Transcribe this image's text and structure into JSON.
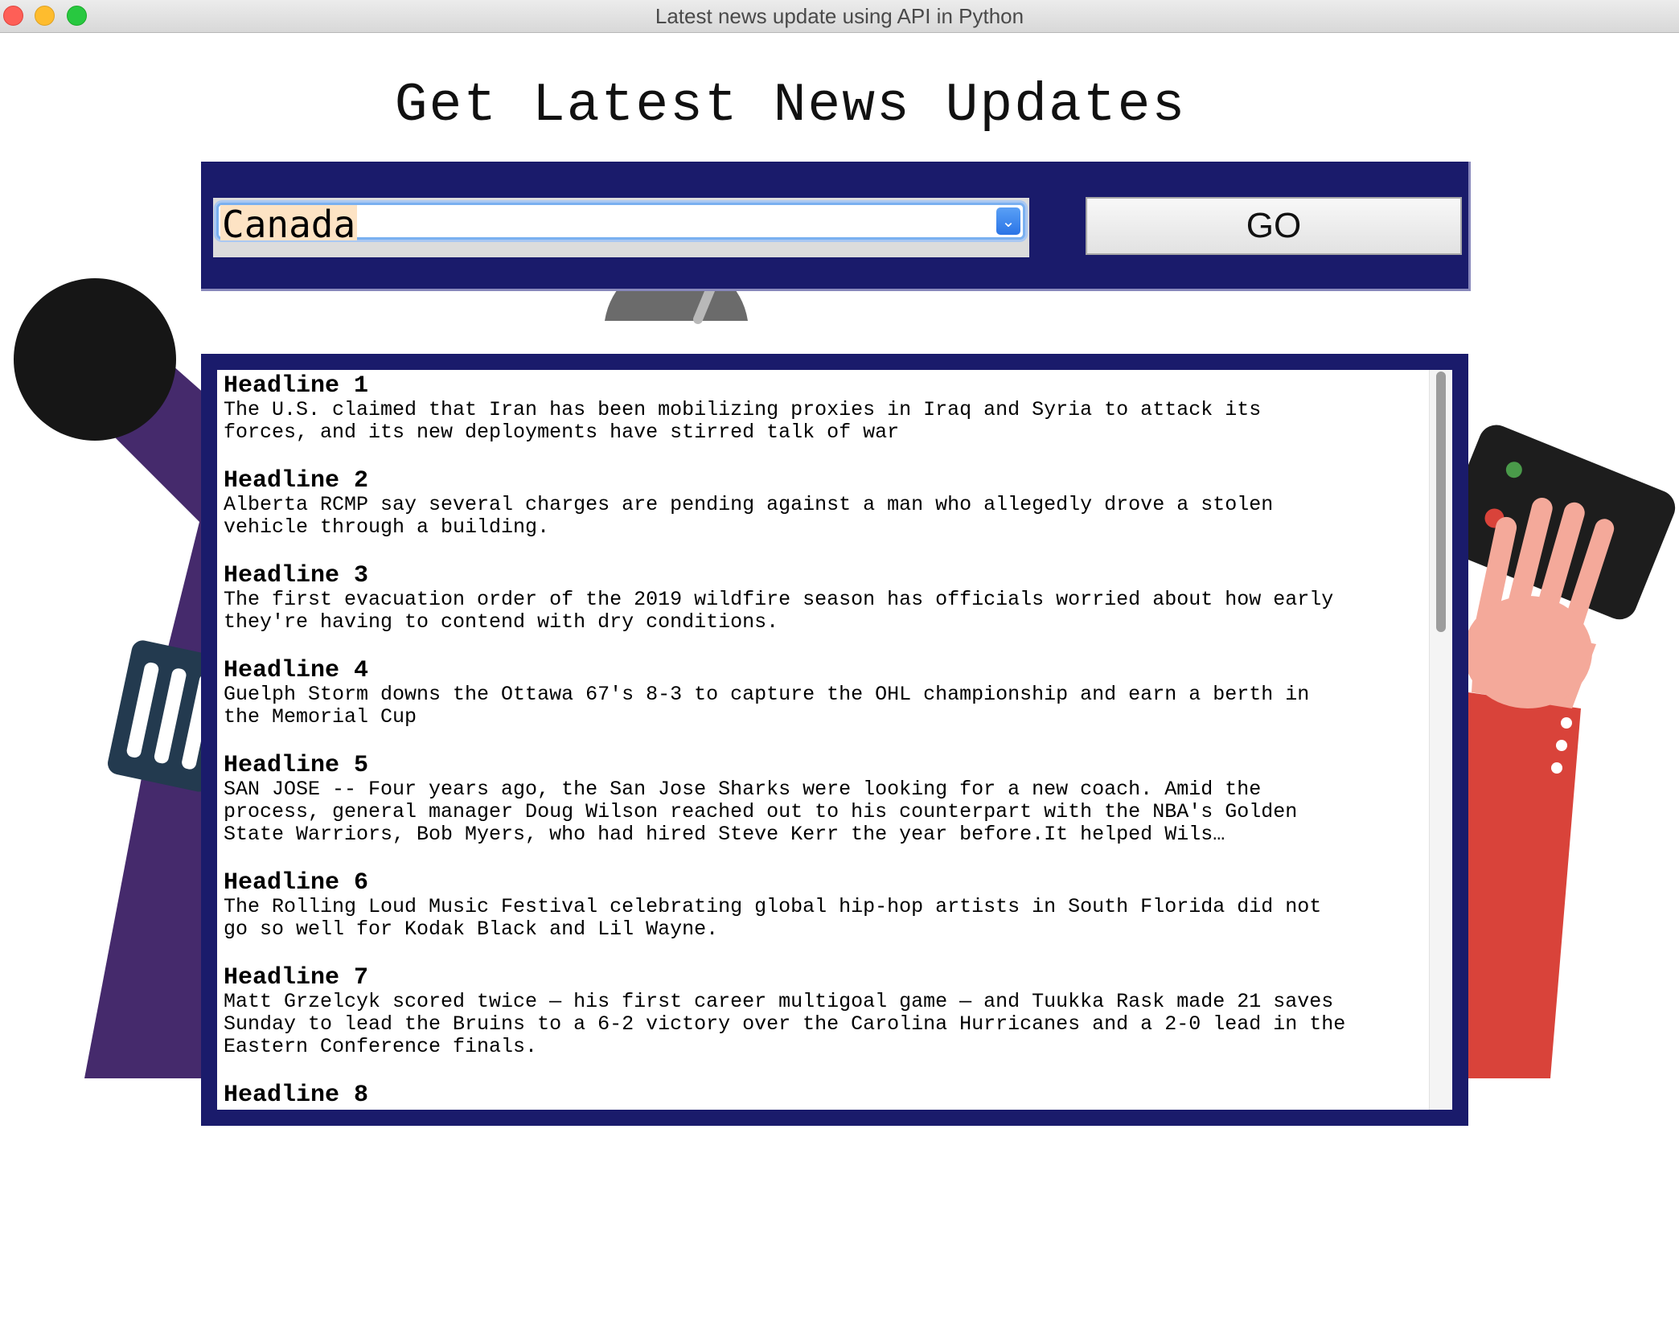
{
  "window": {
    "title": "Latest news update using API in Python"
  },
  "app": {
    "heading": "Get Latest News Updates"
  },
  "controls": {
    "country_selected": "Canada",
    "go_label": "GO"
  },
  "news": {
    "items": [
      {
        "title": "Headline 1",
        "text": "The U.S. claimed that Iran has been mobilizing proxies in Iraq and Syria to attack its\nforces, and its new deployments have stirred talk of war"
      },
      {
        "title": "Headline 2",
        "text": "Alberta RCMP say several charges are pending against a man who allegedly drove a stolen\nvehicle through a building."
      },
      {
        "title": "Headline 3",
        "text": "The first evacuation order of the 2019 wildfire season has officials worried about how early\nthey're having to contend with dry conditions."
      },
      {
        "title": "Headline 4",
        "text": "Guelph Storm downs the Ottawa 67's 8-3 to capture the OHL championship and earn a berth in\nthe Memorial Cup"
      },
      {
        "title": "Headline 5",
        "text": "SAN JOSE -- Four years ago, the San Jose Sharks were looking for a new coach. Amid the\nprocess, general manager Doug Wilson reached out to his counterpart with the NBA's Golden\nState Warriors, Bob Myers, who had hired Steve Kerr the year before.It helped Wils…"
      },
      {
        "title": "Headline 6",
        "text": "The Rolling Loud Music Festival celebrating global hip-hop artists in South Florida did not\ngo so well for Kodak Black and Lil Wayne."
      },
      {
        "title": "Headline 7",
        "text": "Matt Grzelcyk scored twice — his first career multigoal game — and Tuukka Rask made 21 saves\nSunday to lead the Bruins to a 6-2 victory over the Carolina Hurricanes and a 2-0 lead in the\nEastern Conference finals."
      },
      {
        "title": "Headline 8",
        "text": ""
      }
    ]
  },
  "colors": {
    "panel": "#1a1b6b",
    "selection_highlight": "#fde3c4",
    "focus_ring": "#7ab0f0"
  },
  "icons": {
    "dropdown": "chevron-down-icon"
  }
}
